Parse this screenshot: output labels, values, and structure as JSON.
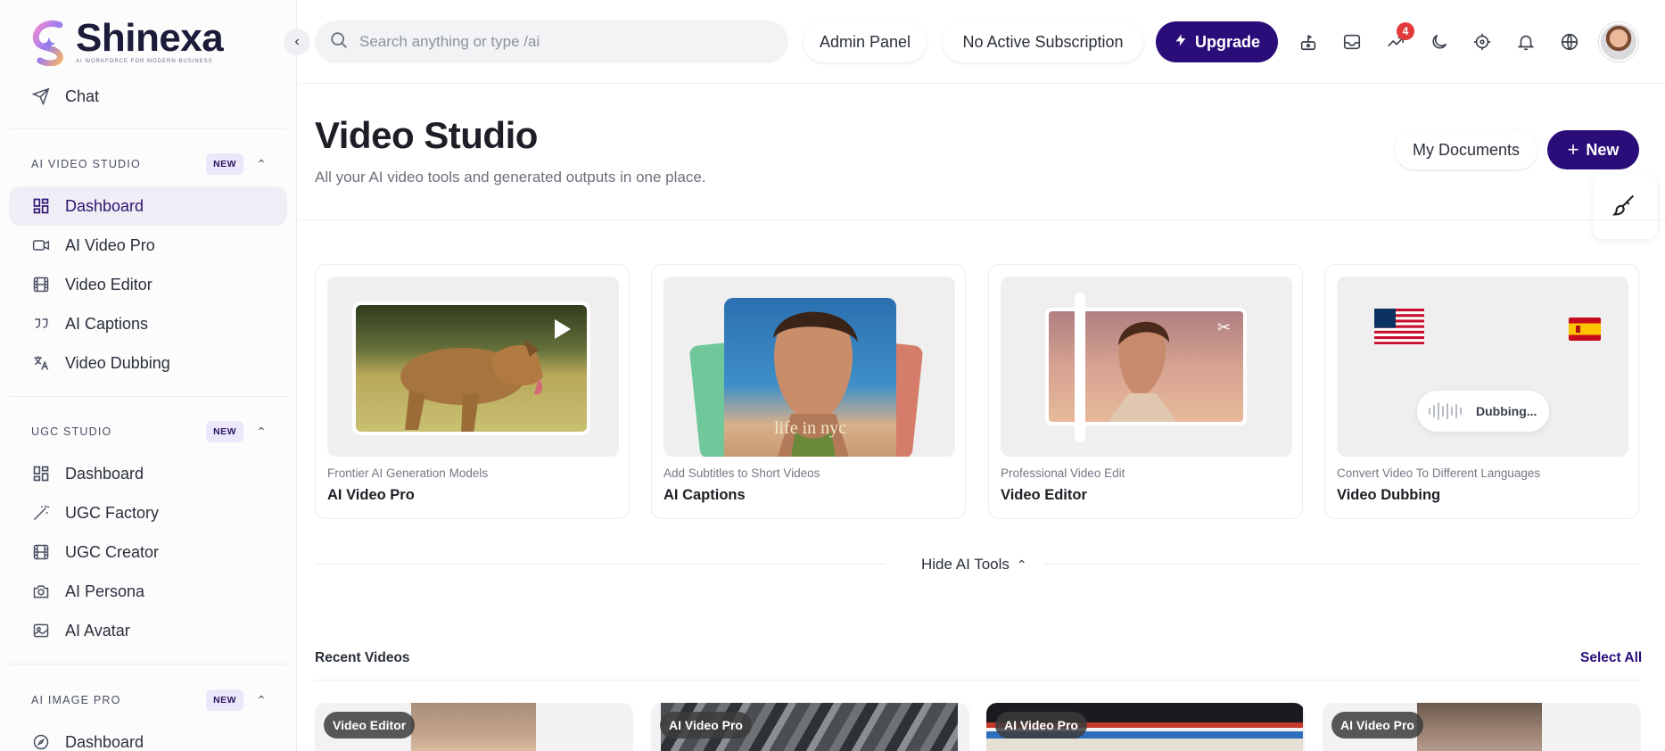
{
  "brand": {
    "name": "Shinexa",
    "tagline": "AI WORKFORCE FOR MODERN BUSINESS"
  },
  "sidebar": {
    "chat": "Chat",
    "sections": [
      {
        "title": "AI VIDEO STUDIO",
        "badge": "NEW",
        "items": [
          "Dashboard",
          "AI Video Pro",
          "Video Editor",
          "AI Captions",
          "Video Dubbing"
        ]
      },
      {
        "title": "UGC STUDIO",
        "badge": "NEW",
        "items": [
          "Dashboard",
          "UGC Factory",
          "UGC Creator",
          "AI Persona",
          "AI Avatar"
        ]
      },
      {
        "title": "AI IMAGE PRO",
        "badge": "NEW",
        "items": [
          "Dashboard"
        ]
      }
    ],
    "active_item": "Dashboard"
  },
  "topbar": {
    "search_placeholder": "Search anything or type /ai",
    "admin_panel": "Admin Panel",
    "subscription": "No Active Subscription",
    "upgrade": "Upgrade",
    "notification_count": "4",
    "icons": [
      "rocket-icon",
      "inbox-icon",
      "trending-icon",
      "moon-icon",
      "crosshair-icon",
      "bell-icon",
      "globe-icon"
    ]
  },
  "page": {
    "title": "Video Studio",
    "subtitle": "All your AI video tools and generated outputs in one place.",
    "my_documents": "My Documents",
    "new_label": "New"
  },
  "tools": [
    {
      "subtitle": "Frontier AI Generation Models",
      "name": "AI Video Pro"
    },
    {
      "subtitle": "Add Subtitles to Short Videos",
      "name": "AI Captions",
      "overlay_text": "life in nyc"
    },
    {
      "subtitle": "Professional Video Edit",
      "name": "Video Editor"
    },
    {
      "subtitle": "Convert Video To Different Languages",
      "name": "Video Dubbing",
      "status": "Dubbing..."
    }
  ],
  "hide_tools": "Hide AI Tools",
  "recent": {
    "title": "Recent Videos",
    "select_all": "Select All",
    "videos": [
      {
        "tag": "Video Editor"
      },
      {
        "tag": "AI Video Pro"
      },
      {
        "tag": "AI Video Pro"
      },
      {
        "tag": "AI Video Pro"
      }
    ]
  },
  "colors": {
    "accent": "#2b0d7a",
    "badge_bg": "#ece7fb",
    "notification": "#e23a3a"
  }
}
